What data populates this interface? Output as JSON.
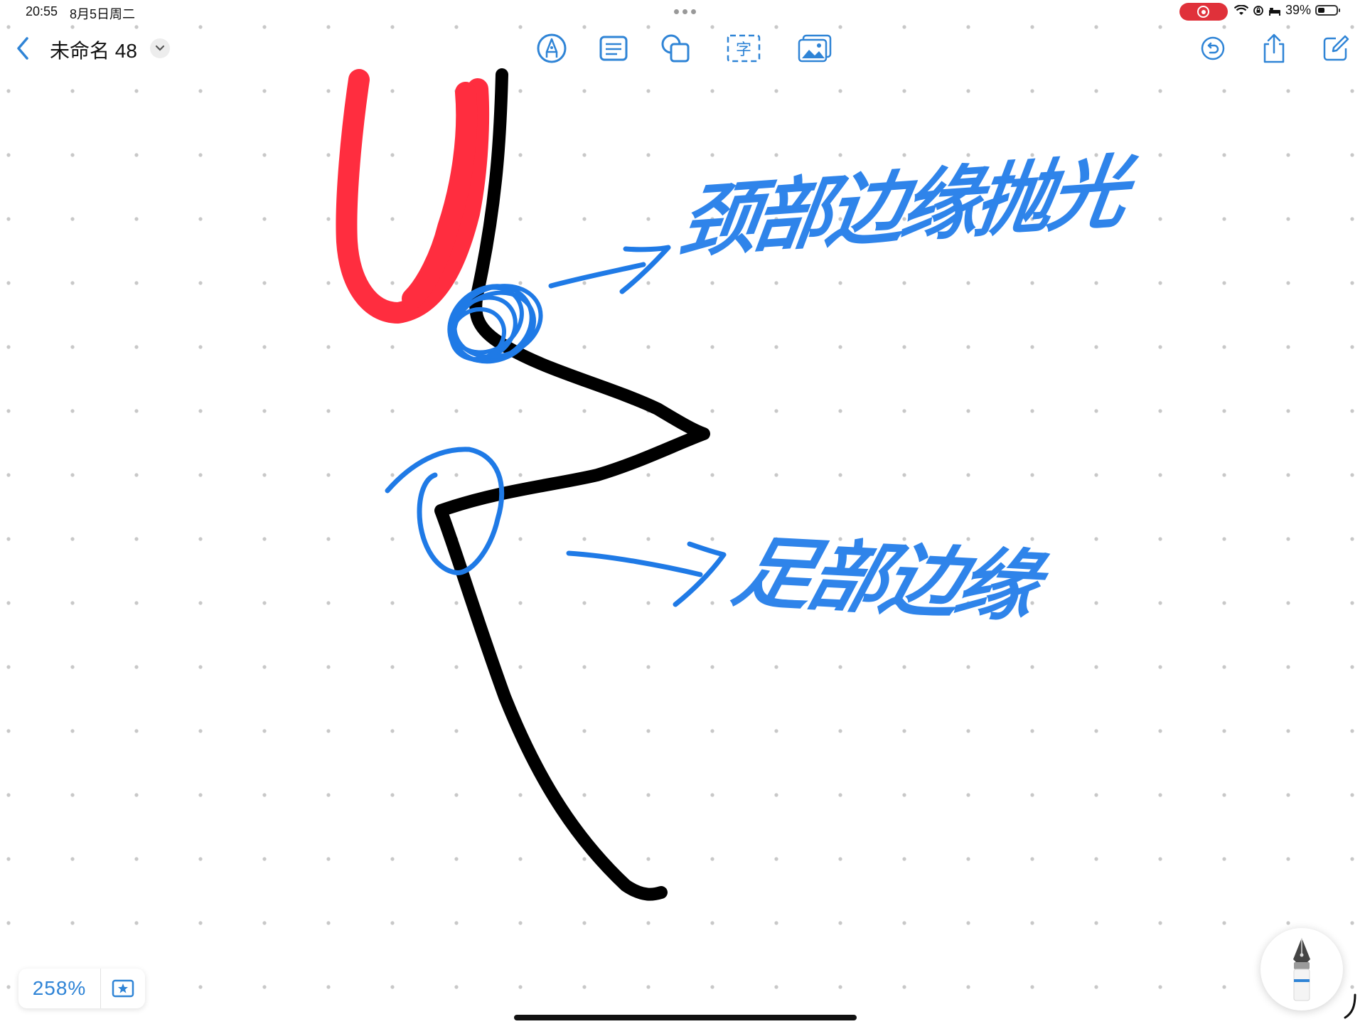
{
  "status_bar": {
    "time": "20:55",
    "date": "8月5日周二",
    "battery": "39%"
  },
  "toolbar": {
    "title": "未命名 48",
    "tools": [
      "markup-tool",
      "note-tool",
      "shapes-tool",
      "text-tool",
      "media-tool"
    ],
    "accent_color": "#2f84d6"
  },
  "annotations": {
    "upper": "颈部边缘抛光",
    "lower": "足部边缘"
  },
  "zoom": {
    "level": "258%"
  },
  "colors": {
    "ink_black": "#000000",
    "ink_red": "#ff2d3f",
    "ink_blue": "#2f84ea"
  }
}
